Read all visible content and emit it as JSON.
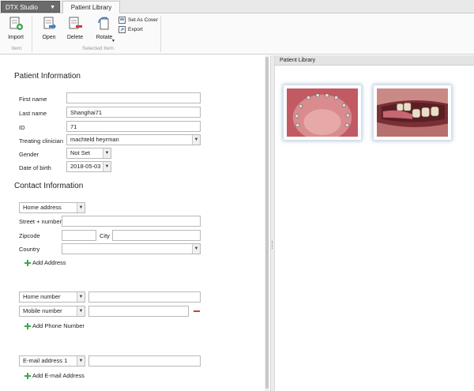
{
  "titlebar": {
    "app_menu": "DTX Studio Implant",
    "active_tab": "Patient Library"
  },
  "ribbon": {
    "import": "Import",
    "open": "Open",
    "delete": "Delete",
    "rotate": "Rotate",
    "set_as_cover": "Set As Cover",
    "export": "Export",
    "group_item": "Item",
    "group_selected": "Selected Item"
  },
  "patient": {
    "section_title": "Patient Information",
    "first_name_label": "First name",
    "first_name": "",
    "last_name_label": "Last name",
    "last_name": "Shanghai71",
    "id_label": "ID",
    "id": "71",
    "clinician_label": "Treating clinician",
    "clinician": "machteld heyrman",
    "gender_label": "Gender",
    "gender": "Not Set",
    "dob_label": "Date of birth",
    "dob": "2018-05-03"
  },
  "contact": {
    "section_title": "Contact Information",
    "address_type": "Home address",
    "street_label": "Street + number",
    "street": "",
    "zip_label": "Zipcode",
    "zip": "",
    "city_label": "City",
    "city": "",
    "country_label": "Country",
    "country": "",
    "add_address": "Add Address",
    "phone1_type": "Home number",
    "phone1": "",
    "phone2_type": "Mobile number",
    "phone2": "",
    "add_phone": "Add Phone Number",
    "email_type": "E-mail address 1",
    "email": "",
    "add_email": "Add E-mail Address"
  },
  "library": {
    "header": "Patient Library"
  },
  "colors": {
    "accent_green": "#3aa84a",
    "remove_red": "#d23a3a",
    "app_button": "#6b6b6b"
  }
}
